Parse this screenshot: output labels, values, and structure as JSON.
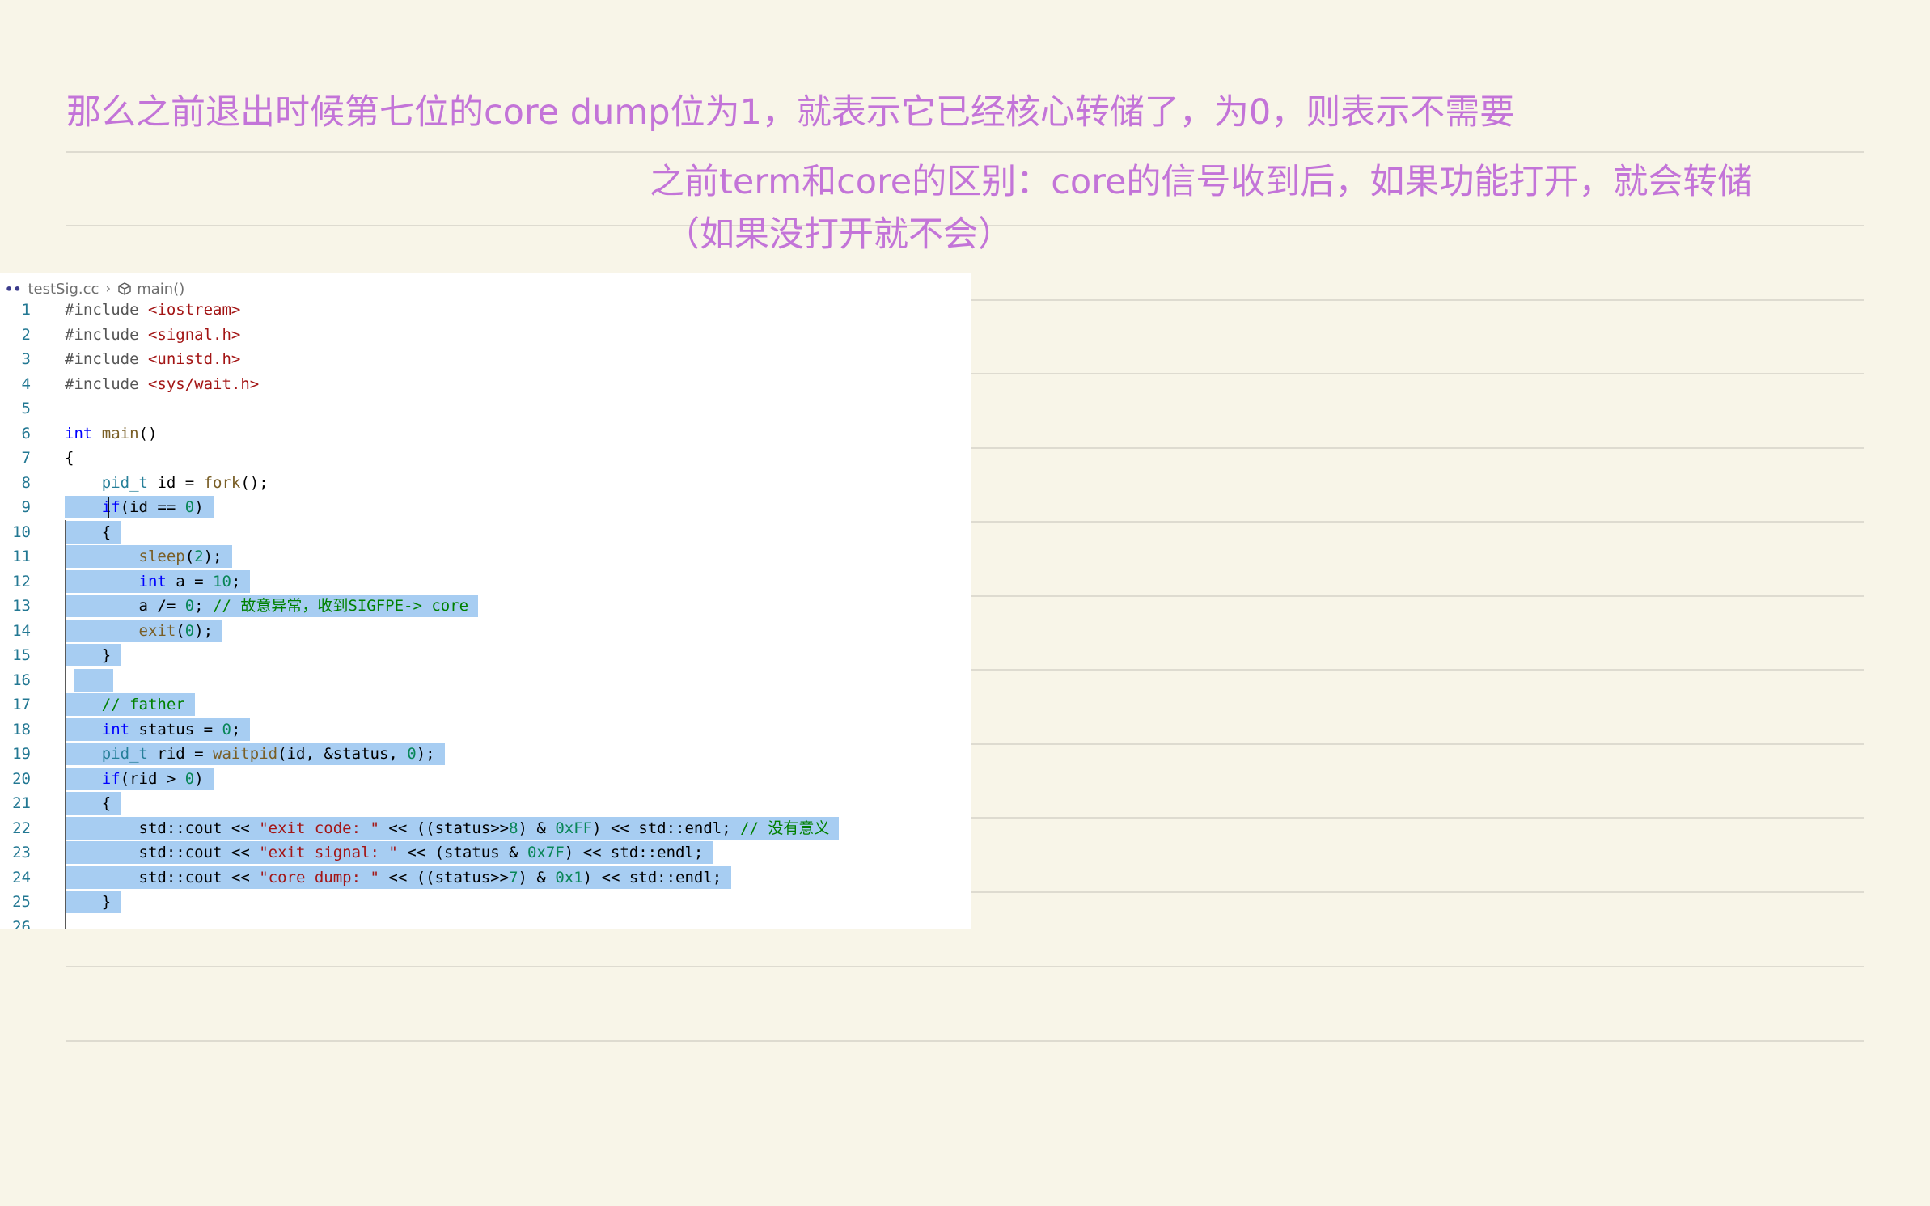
{
  "notes": {
    "line1": "那么之前退出时候第七位的core dump位为1，就表示它已经核心转储了，为0，则表示不需要",
    "line2": "之前term和core的区别：core的信号收到后，如果功能打开，就会转储",
    "line3": "（如果没打开就不会）"
  },
  "editor": {
    "breadcrumb": {
      "file": "testSig.cc",
      "symbol": "main()"
    },
    "lines": [
      {
        "n": "1",
        "code": "#include <iostream>"
      },
      {
        "n": "2",
        "code": "#include <signal.h>"
      },
      {
        "n": "3",
        "code": "#include <unistd.h>"
      },
      {
        "n": "4",
        "code": "#include <sys/wait.h>"
      },
      {
        "n": "5",
        "code": ""
      },
      {
        "n": "6",
        "code": "int main()"
      },
      {
        "n": "7",
        "code": "{"
      },
      {
        "n": "8",
        "code": "    pid_t id = fork();"
      },
      {
        "n": "9",
        "code": "    if(id == 0)"
      },
      {
        "n": "10",
        "code": "    {"
      },
      {
        "n": "11",
        "code": "        sleep(2);"
      },
      {
        "n": "12",
        "code": "        int a = 10;"
      },
      {
        "n": "13",
        "code": "        a /= 0; // 故意异常，收到SIGFPE-> core"
      },
      {
        "n": "14",
        "code": "        exit(0);"
      },
      {
        "n": "15",
        "code": "    }"
      },
      {
        "n": "16",
        "code": ""
      },
      {
        "n": "17",
        "code": "    // father"
      },
      {
        "n": "18",
        "code": "    int status = 0;"
      },
      {
        "n": "19",
        "code": "    pid_t rid = waitpid(id, &status, 0);"
      },
      {
        "n": "20",
        "code": "    if(rid > 0)"
      },
      {
        "n": "21",
        "code": "    {"
      },
      {
        "n": "22",
        "code": "        std::cout << \"exit code: \" << ((status>>8) & 0xFF) << std::endl; // 没有意义"
      },
      {
        "n": "23",
        "code": "        std::cout << \"exit signal: \" << (status & 0x7F) << std::endl;"
      },
      {
        "n": "24",
        "code": "        std::cout << \"core dump: \" << ((status>>7) & 0x1) << std::endl;"
      },
      {
        "n": "25",
        "code": "    }"
      },
      {
        "n": "26",
        "code": ""
      }
    ],
    "selected_lines": [
      "9",
      "10",
      "11",
      "12",
      "13",
      "14",
      "15",
      "16",
      "17",
      "18",
      "19",
      "20",
      "21",
      "22",
      "23",
      "24",
      "25"
    ]
  },
  "colors": {
    "note_text": "#c374d8",
    "background": "#f8f5e8",
    "selection": "#a7cdf2"
  }
}
